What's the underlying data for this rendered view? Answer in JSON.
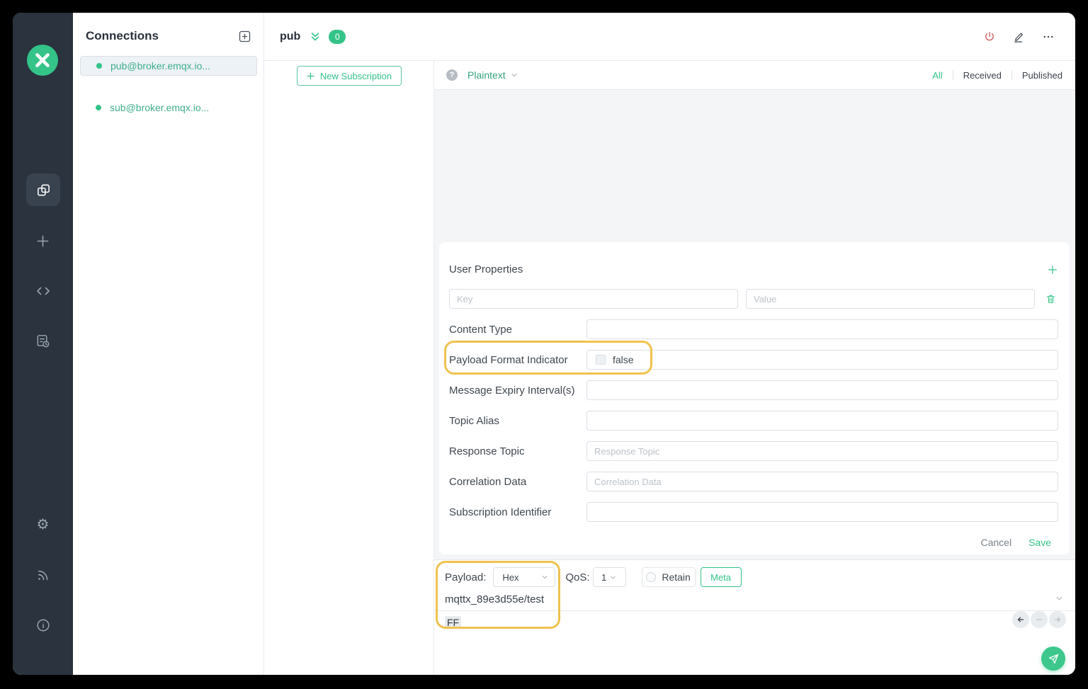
{
  "colors": {
    "accent": "#34c388",
    "danger": "#d05f5f",
    "annotation": "#efc24f",
    "sidebar_bg": "#2a333e"
  },
  "sidebar": {
    "logo_icon": "mqttx-logo",
    "nav_icons": [
      "connections-icon",
      "new-connection-icon",
      "script-icon",
      "log-icon"
    ],
    "bottom_icons": [
      "settings-icon",
      "rss-icon",
      "about-icon"
    ],
    "settings_glyph": "⚙"
  },
  "connections_panel": {
    "title": "Connections",
    "items": [
      {
        "label": "pub@broker.emqx.io...",
        "selected": true
      },
      {
        "label": "sub@broker.emqx.io...",
        "selected": false
      }
    ]
  },
  "topbar": {
    "title": "pub",
    "badge_count": "0"
  },
  "subscriptions_panel": {
    "new_subscription_label": "New Subscription"
  },
  "messages_panel": {
    "help_glyph": "?",
    "codec_label": "Plaintext",
    "tabs": [
      {
        "label": "All",
        "active": true
      },
      {
        "label": "Received",
        "active": false
      },
      {
        "label": "Published",
        "active": false
      }
    ]
  },
  "meta_form": {
    "title": "User Properties",
    "user_properties": {
      "key_placeholder": "Key",
      "value_placeholder": "Value"
    },
    "fields": {
      "content_type": {
        "label": "Content Type",
        "value": ""
      },
      "payload_format_indicator": {
        "label": "Payload Format Indicator",
        "value": "false"
      },
      "message_expiry_interval": {
        "label": "Message Expiry Interval(s)",
        "value": ""
      },
      "topic_alias": {
        "label": "Topic Alias",
        "value": ""
      },
      "response_topic": {
        "label": "Response Topic",
        "placeholder": "Response Topic"
      },
      "correlation_data": {
        "label": "Correlation Data",
        "placeholder": "Correlation Data"
      },
      "subscription_identifier": {
        "label": "Subscription Identifier",
        "value": ""
      }
    },
    "cancel_label": "Cancel",
    "save_label": "Save"
  },
  "publish_bar": {
    "payload_label": "Payload:",
    "payload_format": "Hex",
    "qos_label": "QoS:",
    "qos_value": "1",
    "retain_label": "Retain",
    "meta_button_label": "Meta",
    "topic": "mqttx_89e3d55e/test",
    "payload_value": "FF"
  }
}
